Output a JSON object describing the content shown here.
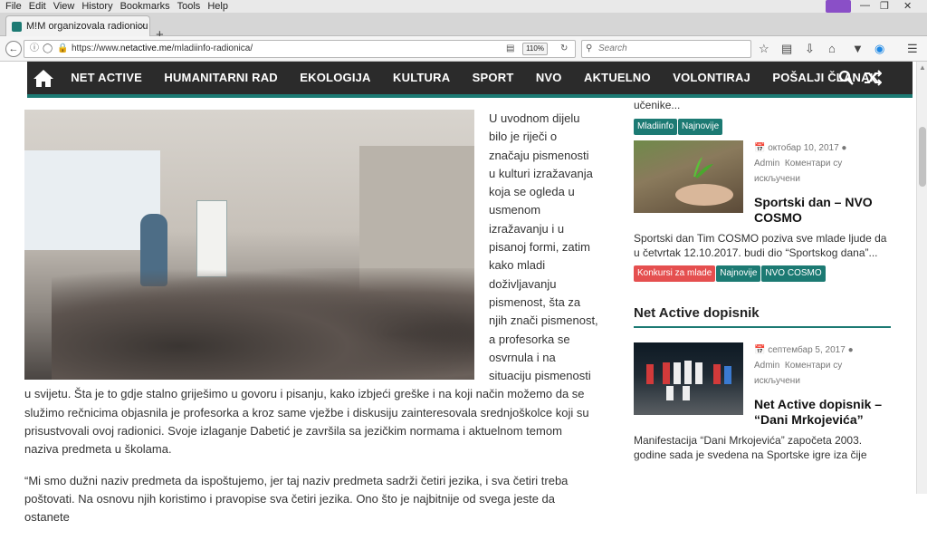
{
  "browser": {
    "menu": [
      "File",
      "Edit",
      "View",
      "History",
      "Bookmarks",
      "Tools",
      "Help"
    ],
    "tab_title": "M!M organizovala radionicu \"Pis",
    "url_prefix": "https://www.",
    "url_host": "netactive.me",
    "url_path": "/mladiinfo-radionica/",
    "zoom": "110%",
    "search_placeholder": "Search"
  },
  "site_nav": {
    "items": [
      "NET ACTIVE",
      "HUMANITARNI RAD",
      "EKOLOGIJA",
      "KULTURA",
      "SPORT",
      "NVO",
      "AKTUELNO",
      "VOLONTIRAJ",
      "POŠALJI ČLANAK"
    ]
  },
  "article": {
    "p1": "U uvodnom dijelu bilo je riječi o značaju pismenosti u kulturi izražavanja koja se ogleda u usmenom izražavanju i u pisanoj formi, zatim kako mladi doživljavanju pismenost, šta za njih znači pismenost, a profesorka se osvrnula i na situaciju pismenosti u svijetu. Šta je to gdje stalno griješimo u govoru i pisanju, kako izbjeći greške i na koji način možemo da se služimo rečnicima objasnila je profesorka a kroz same vježbe i diskusiju zainteresovala srednjoškolce koji su prisustvovali ovoj radionici. Svoje izlaganje Dabetić je završila sa jezičkim normama i aktuelnom temom naziva predmeta u školama.",
    "p2": "“Mi smo dužni naziv predmeta da ispoštujemo, jer taj naziv predmeta sadrži četiri jezika, i sva četiri treba poštovati. Na osnovu njih koristimo i pravopise sva četiri jezika. Ono što je najbitnije od svega jeste da ostanete"
  },
  "sidebar": {
    "top_snippet": "učenike...",
    "top_tags": [
      "Mladiinfo",
      "Najnovije"
    ],
    "post1": {
      "date": "октобар 10, 2017",
      "author": "Admin",
      "comments": "Коментари су искључени",
      "title": "Sportski dan – NVO COSMO",
      "excerpt": "Sportski dan Tim COSMO poziva sve mlade ljude da u četvrtak 12.10.2017. budi dio “Sportskog dana”...",
      "tags": [
        "Konkursi za mlade",
        "Najnovije",
        "NVO COSMO"
      ]
    },
    "section_title": "Net Active dopisnik",
    "post2": {
      "date": "септембар 5, 2017",
      "author": "Admin",
      "comments": "Коментари су искључени",
      "title": "Net Active dopisnik – “Dani Mrkojevića”",
      "excerpt": "Manifestacija “Dani Mrkojevića” započeta 2003. godine sada je svedena na Sportske igre iza čije"
    }
  },
  "colors": {
    "accent": "#1c7a73",
    "nav_bg": "#2b2b2b",
    "tag_red": "#e54f4f"
  }
}
